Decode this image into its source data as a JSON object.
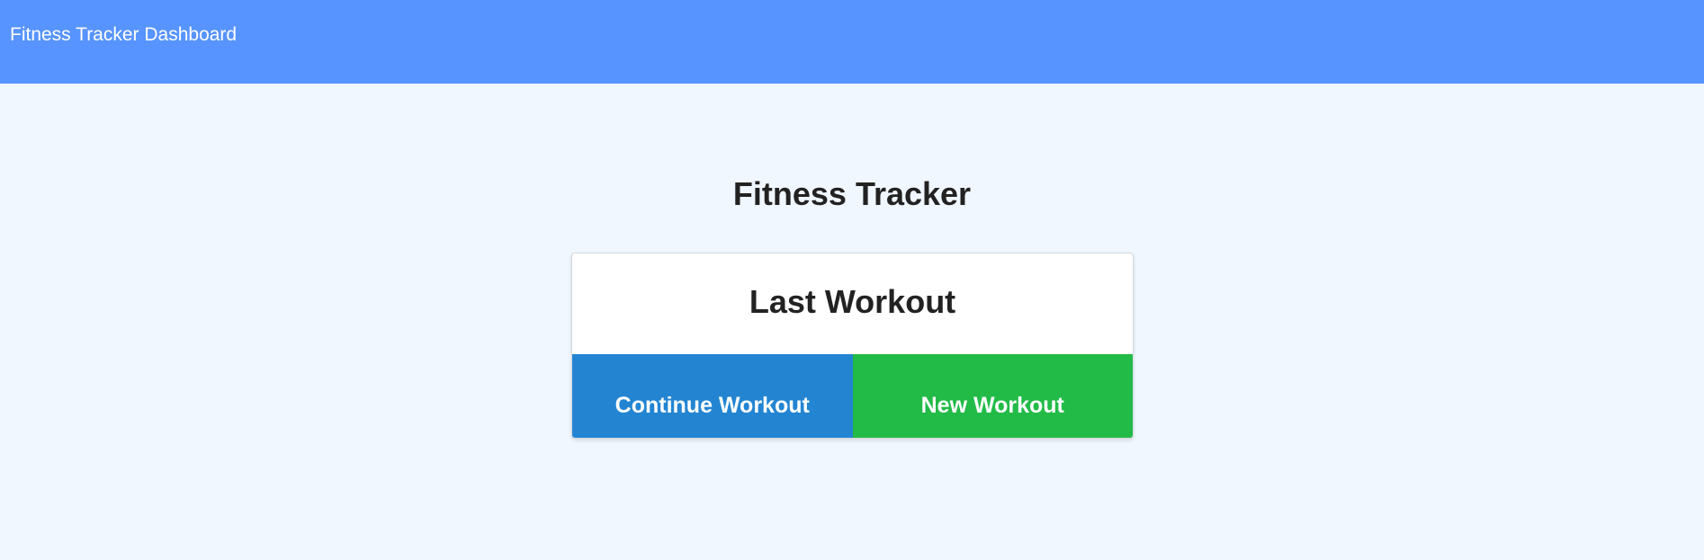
{
  "header": {
    "brand": "Fitness Tracker Dashboard"
  },
  "main": {
    "title": "Fitness Tracker",
    "card": {
      "title": "Last Workout",
      "continue_label": "Continue Workout",
      "new_label": "New Workout"
    }
  },
  "colors": {
    "header_bg": "#5794ff",
    "page_bg": "#f0f7ff",
    "continue_button": "#2385d2",
    "new_button": "#22bb47"
  }
}
